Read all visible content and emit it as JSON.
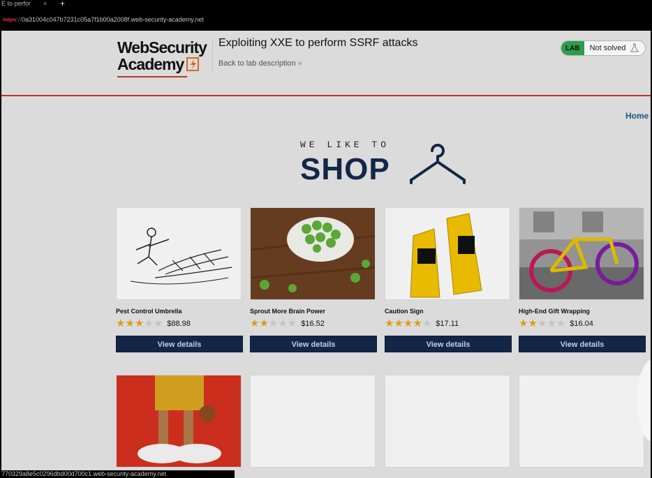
{
  "browser": {
    "tab_title": "E to perfor",
    "tab_close": "×",
    "tab_new": "+",
    "url_scheme": "https",
    "url_sep": "://",
    "url_host": "0a31004c047b7231c05a7f1b00a2008f.web-security-academy.net",
    "status_url": "770329a8e5c0296dbd00d700c1.web-security-academy.net"
  },
  "header": {
    "logo_line1": "WebSecurity",
    "logo_line2": "Academy",
    "lab_title": "Exploiting XXE to perform SSRF attacks",
    "back_link": "Back to lab description",
    "back_chevrons": "»",
    "status_badge": "LAB",
    "status_text": "Not solved"
  },
  "nav": {
    "home": "Home"
  },
  "banner": {
    "small": "WE LIKE TO",
    "big": "SHOP"
  },
  "colors": {
    "accent_red": "#c0392b",
    "navy": "#14284b",
    "star": "#e8a21b",
    "lab_green": "#2ea44f"
  },
  "products": [
    {
      "name": "Pest Control Umbrella",
      "rating": 3,
      "price": "$88.98",
      "button": "View details",
      "image": "umbrella-sketch"
    },
    {
      "name": "Sprout More Brain Power",
      "rating": 2,
      "price": "$16.52",
      "button": "View details",
      "image": "sprouts"
    },
    {
      "name": "Caution Sign",
      "rating": 4,
      "price": "$17.11",
      "button": "View details",
      "image": "caution-sign"
    },
    {
      "name": "High-End Gift Wrapping",
      "rating": 2,
      "price": "$16.04",
      "button": "View details",
      "image": "knitted-bike"
    }
  ],
  "products_row2": [
    {
      "image": "figure-shoes"
    },
    {
      "image": "blank"
    },
    {
      "image": "blank"
    },
    {
      "image": "blank"
    }
  ]
}
